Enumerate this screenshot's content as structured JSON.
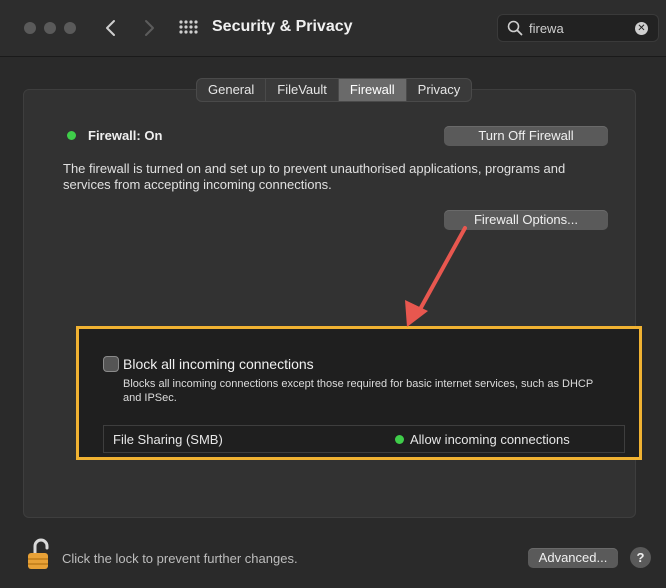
{
  "window": {
    "title": "Security & Privacy"
  },
  "search": {
    "value": "firewa"
  },
  "tabs": [
    {
      "label": "General",
      "active": false
    },
    {
      "label": "FileVault",
      "active": false
    },
    {
      "label": "Firewall",
      "active": true
    },
    {
      "label": "Privacy",
      "active": false
    }
  ],
  "firewall": {
    "status": "Firewall: On",
    "toggle_label": "Turn Off Firewall",
    "description": "The firewall is turned on and set up to prevent unauthorised applications, programs and services from accepting incoming connections.",
    "options_label": "Firewall Options..."
  },
  "options": {
    "block_label": "Block all incoming connections",
    "block_checked": false,
    "block_description": "Blocks all incoming connections except those required for basic internet services, such as DHCP and IPSec.",
    "apps": [
      {
        "name": "File Sharing (SMB)",
        "status": "Allow incoming connections"
      }
    ]
  },
  "footer": {
    "lock_text": "Click the lock to prevent further changes.",
    "advanced_label": "Advanced...",
    "help_label": "?"
  },
  "colors": {
    "status_green": "#3fcd4a",
    "highlight_border": "#f0b232",
    "arrow": "#e8574f"
  }
}
